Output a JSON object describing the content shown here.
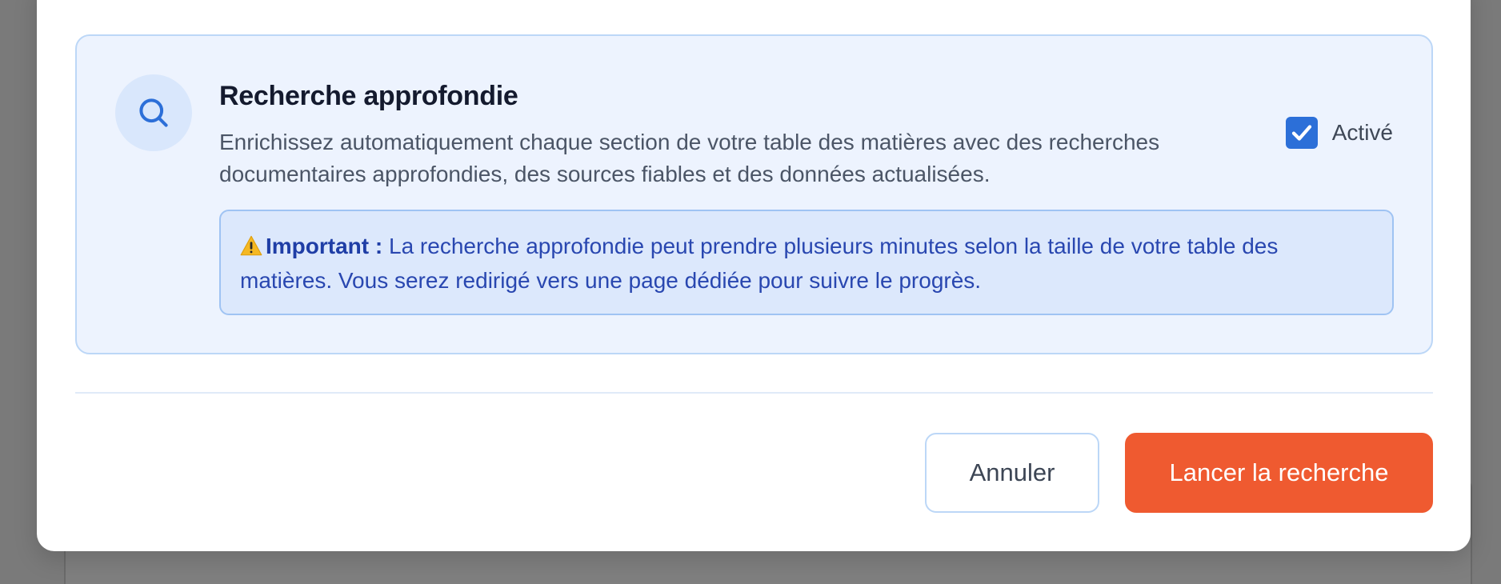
{
  "research": {
    "title": "Recherche approfondie",
    "description": "Enrichissez automatiquement chaque section de votre table des matières avec des recherches documentaires approfondies, des sources fiables et des données actualisées.",
    "icon": "search-icon",
    "toggle": {
      "label": "Activé",
      "checked": true
    },
    "warning": {
      "icon": "warning-icon",
      "label": "Important :",
      "text": " La recherche approfondie peut prendre plusieurs minutes selon la taille de votre table des matières. Vous serez redirigé vers une page dédiée pour suivre le progrès."
    }
  },
  "footer": {
    "cancel_label": "Annuler",
    "launch_label": "Lancer la recherche"
  },
  "colors": {
    "accent": "#ef5a30",
    "checkbox": "#2c6fd8",
    "panel_bg": "#edf3fe",
    "warning_text": "#2947b0"
  }
}
